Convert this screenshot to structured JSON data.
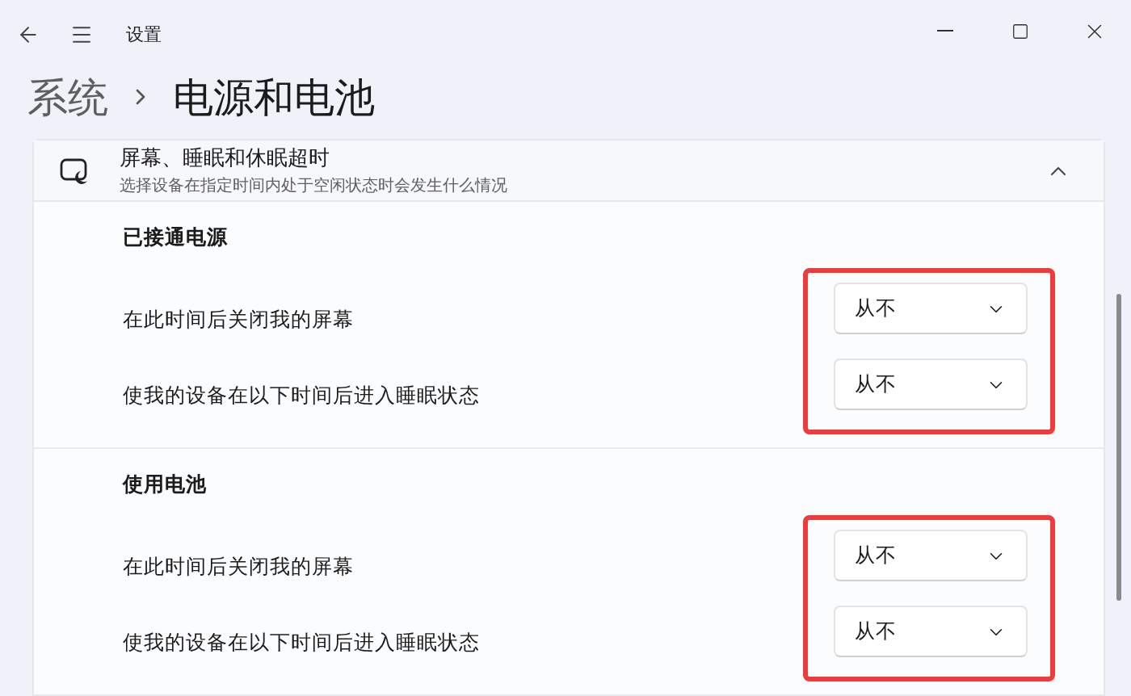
{
  "window": {
    "title": "设置"
  },
  "breadcrumb": [
    {
      "label": "系统",
      "current": false
    },
    {
      "label": "电源和电池",
      "current": true
    }
  ],
  "card": {
    "title": "屏幕、睡眠和休眠超时",
    "subtitle": "选择设备在指定时间内处于空闲状态时会发生什么情况",
    "expanded": true,
    "sections": [
      {
        "heading": "已接通电源",
        "highlighted": true,
        "rows": [
          {
            "label": "在此时间后关闭我的屏幕",
            "value": "从不"
          },
          {
            "label": "使我的设备在以下时间后进入睡眠状态",
            "value": "从不"
          }
        ]
      },
      {
        "heading": "使用电池",
        "highlighted": true,
        "rows": [
          {
            "label": "在此时间后关闭我的屏幕",
            "value": "从不"
          },
          {
            "label": "使我的设备在以下时间后进入睡眠状态",
            "value": "从不"
          }
        ]
      }
    ]
  }
}
